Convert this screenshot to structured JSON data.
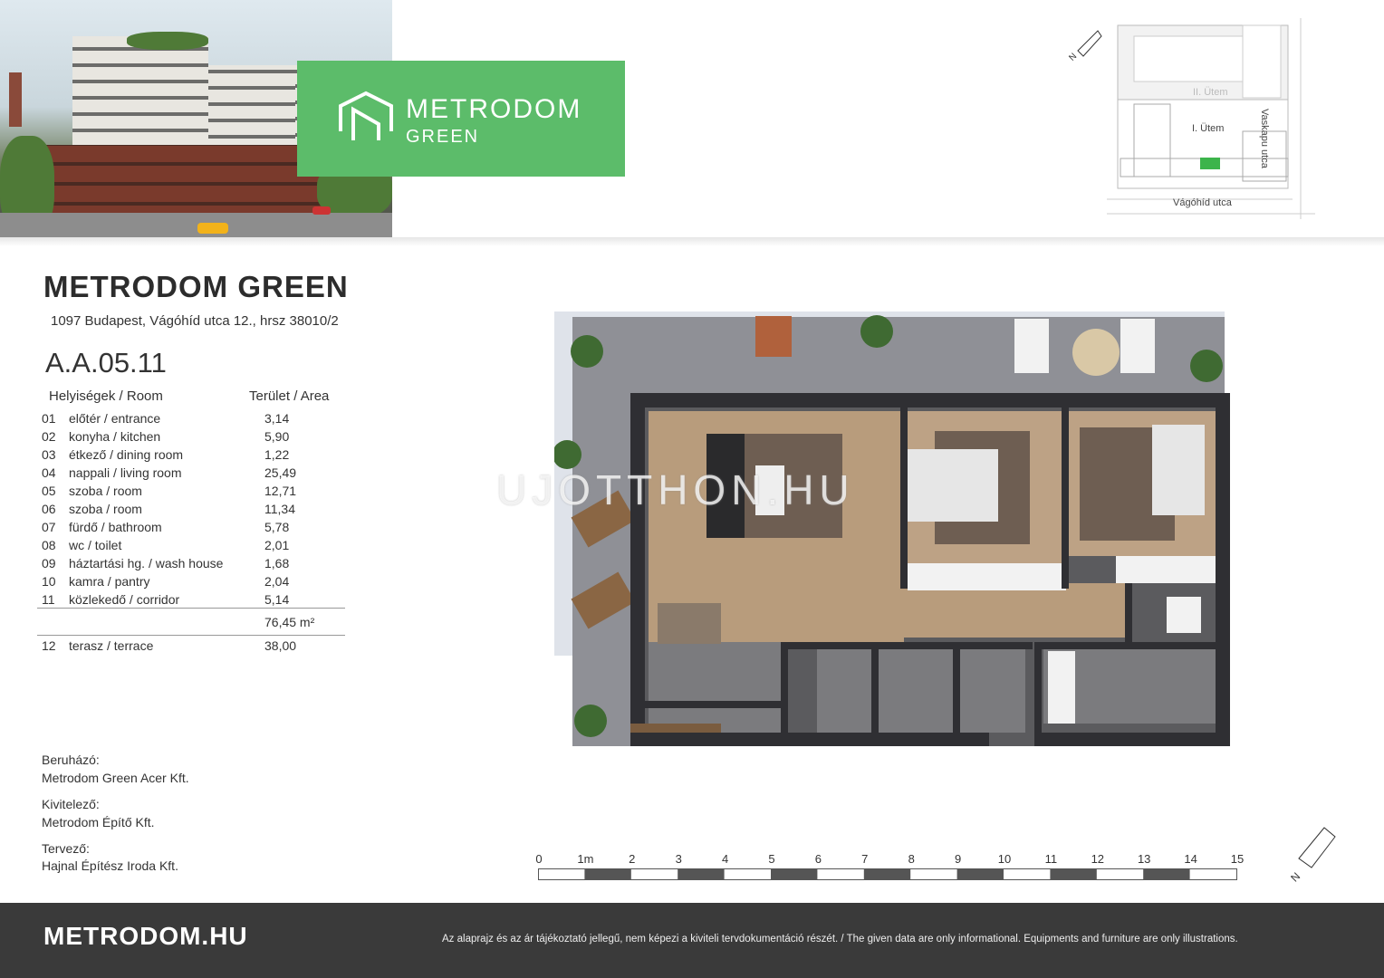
{
  "brand": {
    "logo_line1": "METRODOM",
    "logo_line2": "GREEN",
    "green_color": "#5cbc6a"
  },
  "sitemap": {
    "phase2": "II. Ütem",
    "phase1": "I. Ütem",
    "street_right": "Vaskapu utca",
    "street_bottom": "Vágóhíd utca"
  },
  "project": {
    "title": "METRODOM GREEN",
    "address": "1097 Budapest, Vágóhíd utca 12., hrsz 38010/2",
    "unit": "A.A.05.11"
  },
  "table": {
    "header_room": "Helyiségek / Room",
    "header_area": "Terület / Area",
    "rows": [
      {
        "no": "01",
        "label": "előtér / entrance",
        "area": "3,14"
      },
      {
        "no": "02",
        "label": "konyha / kitchen",
        "area": "5,90"
      },
      {
        "no": "03",
        "label": "étkező / dining room",
        "area": "1,22"
      },
      {
        "no": "04",
        "label": "nappali / living room",
        "area": "25,49"
      },
      {
        "no": "05",
        "label": "szoba / room",
        "area": "12,71"
      },
      {
        "no": "06",
        "label": "szoba / room",
        "area": "11,34"
      },
      {
        "no": "07",
        "label": "fürdő / bathroom",
        "area": "5,78"
      },
      {
        "no": "08",
        "label": "wc / toilet",
        "area": "2,01"
      },
      {
        "no": "09",
        "label": "háztartási hg. / wash house",
        "area": "1,68"
      },
      {
        "no": "10",
        "label": "kamra / pantry",
        "area": "2,04"
      },
      {
        "no": "11",
        "label": "közlekedő / corridor",
        "area": "5,14"
      }
    ],
    "total": "76,45 m²",
    "terrace": {
      "no": "12",
      "label": "terasz / terrace",
      "area": "38,00"
    }
  },
  "credits": {
    "investor_label": "Beruházó:",
    "investor": "Metrodom Green Acer Kft.",
    "contractor_label": "Kivitelező:",
    "contractor": "Metrodom Építő Kft.",
    "designer_label": "Tervező:",
    "designer": "Hajnal Építész Iroda Kft."
  },
  "watermark": "UJOTTHON.HU",
  "scale": {
    "ticks": [
      "0",
      "1m",
      "2",
      "3",
      "4",
      "5",
      "6",
      "7",
      "8",
      "9",
      "10",
      "11",
      "12",
      "13",
      "14",
      "15"
    ]
  },
  "footer": {
    "site": "METRODOM.HU",
    "disclaimer": "Az alaprajz és az ár tájékoztató jellegű, nem képezi a kiviteli tervdokumentáció részét. / The given data are only informational. Equipments and furniture are only illustrations.",
    "background": "#3a3a3a"
  },
  "icons": [
    "north-arrow-icon",
    "metrodom-logo-icon"
  ]
}
